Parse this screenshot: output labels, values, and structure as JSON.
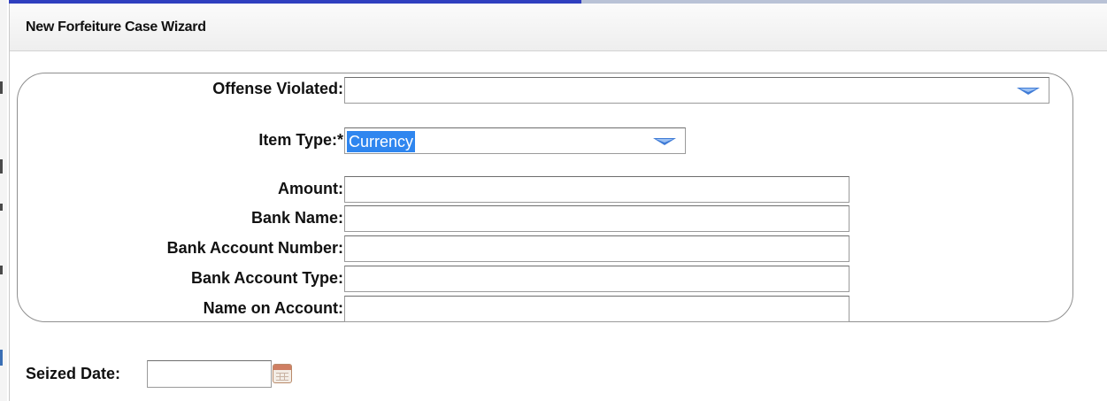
{
  "window": {
    "title": "New Forfeiture Case Wizard"
  },
  "form": {
    "offense_violated": {
      "label": "Offense Violated:",
      "value": ""
    },
    "item_type": {
      "label": "Item Type:*",
      "value": "Currency"
    },
    "amount": {
      "label": "Amount:",
      "value": ""
    },
    "bank_name": {
      "label": "Bank Name:",
      "value": ""
    },
    "bank_account_number": {
      "label": "Bank Account Number:",
      "value": ""
    },
    "bank_account_type": {
      "label": "Bank Account Type:",
      "value": ""
    },
    "name_on_account": {
      "label": "Name on Account:",
      "value": ""
    },
    "seized_date": {
      "label": "Seized Date:",
      "value": ""
    }
  },
  "icons": {
    "dropdown": "chevron-down-icon",
    "calendar": "calendar-icon"
  },
  "colors": {
    "selection": "#2f86ef",
    "arrow": "#3f7bd6",
    "accent": "#2f3fbf"
  }
}
